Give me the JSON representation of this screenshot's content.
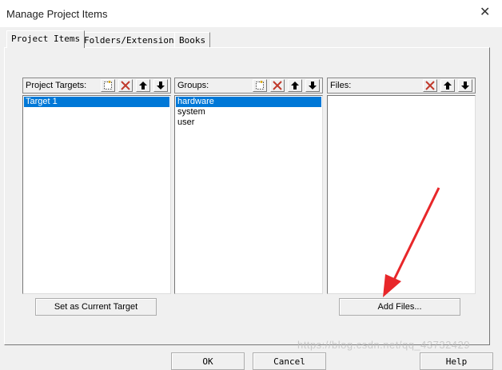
{
  "window": {
    "title": "Manage Project Items",
    "close_icon": "close-icon"
  },
  "tabs": [
    {
      "label": "Project Items",
      "active": true
    },
    {
      "label": "Folders/Extensions",
      "active": false
    },
    {
      "label": "Books",
      "active": false
    }
  ],
  "targets": {
    "header": "Project Targets:",
    "items": [
      "Target 1"
    ],
    "selected": "Target 1",
    "set_current_label": "Set as Current Target"
  },
  "groups": {
    "header": "Groups:",
    "items": [
      "hardware",
      "system",
      "user"
    ],
    "selected": "hardware"
  },
  "files": {
    "header": "Files:",
    "items": [],
    "add_files_label": "Add Files..."
  },
  "footer": {
    "ok_label": "OK",
    "cancel_label": "Cancel",
    "help_label": "Help"
  },
  "watermark": "https://blog.csdn.net/qq_43732429",
  "colors": {
    "selection": "#0078d7",
    "annotation_arrow": "#e8272a",
    "delete_icon": "#c0392b"
  }
}
